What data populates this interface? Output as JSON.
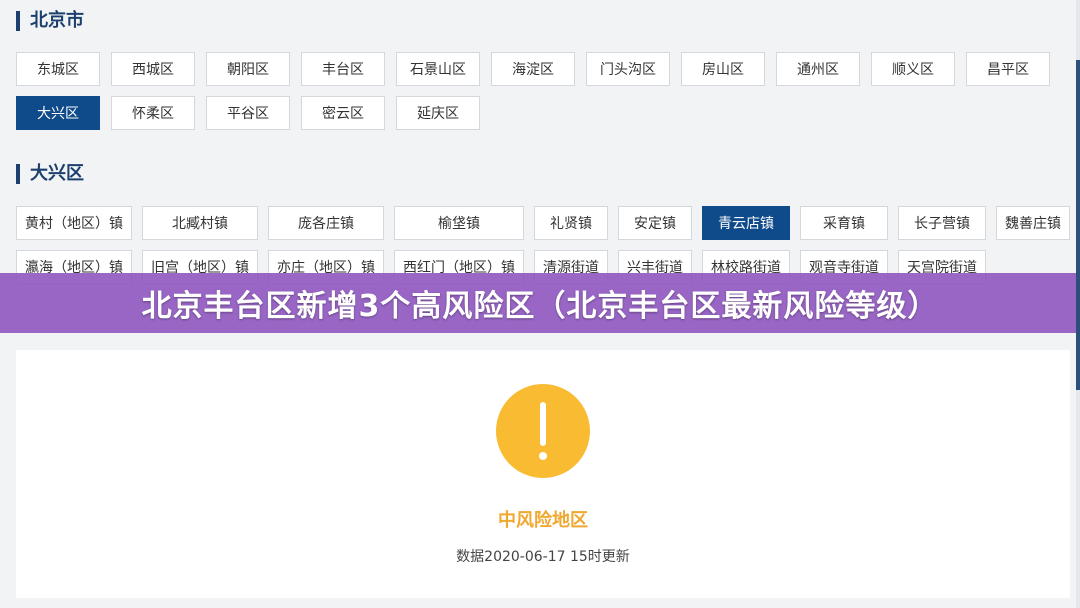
{
  "city_section": {
    "title": "北京市",
    "districts": [
      "东城区",
      "西城区",
      "朝阳区",
      "丰台区",
      "石景山区",
      "海淀区",
      "门头沟区",
      "房山区",
      "通州区",
      "顺义区",
      "昌平区",
      "大兴区",
      "怀柔区",
      "平谷区",
      "密云区",
      "延庆区"
    ],
    "selected_district": "大兴区"
  },
  "district_section": {
    "title": "大兴区",
    "towns": [
      "黄村（地区）镇",
      "北臧村镇",
      "庞各庄镇",
      "榆垡镇",
      "礼贤镇",
      "安定镇",
      "青云店镇",
      "采育镇",
      "长子营镇",
      "魏善庄镇",
      "瀛海（地区）镇",
      "旧宫（地区）镇",
      "亦庄（地区）镇",
      "西红门（地区）镇",
      "清源街道",
      "兴丰街道",
      "林校路街道",
      "观音寺街道",
      "天宫院街道"
    ],
    "selected_town": "青云店镇"
  },
  "overlay": {
    "headline": "北京丰台区新增3个高风险区（北京丰台区最新风险等级）"
  },
  "result": {
    "icon": "exclamation-warning-icon",
    "risk_level": "中风险地区",
    "update_time": "数据2020-06-17 15时更新"
  },
  "colors": {
    "primary": "#0f4a8a",
    "warning": "#f8bb32",
    "risk_text": "#f0a830",
    "overlay": "#8c52be"
  }
}
